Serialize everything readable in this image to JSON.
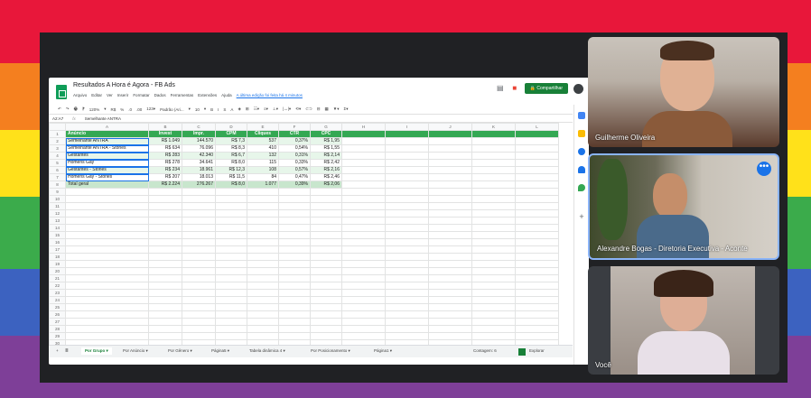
{
  "frame": {
    "stripe_colors": [
      "#e8173a",
      "#f47f1f",
      "#ffe11a",
      "#3bab4b",
      "#3c62c0",
      "#7e3f98"
    ]
  },
  "sheet": {
    "doc_title": "Resultados A Hora é Agora - FB Ads",
    "menus": [
      "Arquivo",
      "Editar",
      "Ver",
      "Inserir",
      "Formatar",
      "Dados",
      "Ferramentas",
      "Extensões",
      "Ajuda"
    ],
    "last_edit": "A última edição foi feita há 4 minutos",
    "share_label": "Compartilhar",
    "toolbar_items": [
      "↶",
      "↷",
      "🖶",
      "⁋",
      "120%",
      "▾",
      "R$",
      "%",
      ".0",
      ".00",
      "123▾",
      "Padrão (Ari...",
      "▾",
      "10",
      "▾",
      "B",
      "I",
      "S",
      "A",
      "◈",
      "⊞",
      "☷▾",
      "≡▾",
      "⊥▾",
      "|↔|▾",
      "⟲▾",
      "⊂⊃",
      "⊟",
      "▦",
      "▼▾",
      "Σ▾"
    ],
    "cell_ref": "A2:A7",
    "fx": "fx",
    "formula_value": "Semelhante ANTRA",
    "columns": [
      "A",
      "B",
      "C",
      "D",
      "E",
      "F",
      "G",
      "H",
      "I",
      "J",
      "K",
      "L"
    ],
    "headers": [
      "Anúncio",
      "Invest",
      "Impr.",
      "CPM",
      "Cliques",
      "CTR",
      "CPC"
    ],
    "rows": [
      [
        "Semelhante ANTRA",
        "R$ 1.049",
        "144.570",
        "R$ 7,3",
        "537",
        "0,37%",
        "R$ 1,95"
      ],
      [
        "Semelhante ANTRA - Stories",
        "R$ 634",
        "76.096",
        "R$ 8,3",
        "410",
        "0,54%",
        "R$ 1,55"
      ],
      [
        "Gestantes",
        "R$ 283",
        "42.340",
        "R$ 6,7",
        "132",
        "0,31%",
        "R$ 2,14"
      ],
      [
        "Homens Gay",
        "R$ 278",
        "34.641",
        "R$ 8,0",
        "115",
        "0,33%",
        "R$ 2,42"
      ],
      [
        "Gestantes - Stories",
        "R$ 234",
        "18.961",
        "R$ 12,3",
        "108",
        "0,57%",
        "R$ 2,16"
      ],
      [
        "Homens Gay - Stories",
        "R$ 207",
        "18.013",
        "R$ 11,5",
        "84",
        "0,47%",
        "R$ 2,46"
      ]
    ],
    "total": [
      "Total geral",
      "R$ 2.224",
      "276.267",
      "R$ 8,0",
      "1.077",
      "0,39%",
      "R$ 2,06"
    ],
    "row_numbers": [
      "1",
      "2",
      "3",
      "4",
      "5",
      "6",
      "7",
      "8",
      "9",
      "10",
      "11",
      "12",
      "13",
      "14",
      "15",
      "16",
      "17",
      "18",
      "19",
      "20",
      "21",
      "22",
      "23",
      "24",
      "25",
      "26",
      "27",
      "28",
      "29",
      "30"
    ],
    "tabs": [
      "Por Grupo ▾",
      "Por Anúncio ▾",
      "Por Gênero ▾",
      "Página5 ▾",
      "Tabela dinâmica 4 ▾",
      "Por Posicionamento ▾",
      "Página1 ▾"
    ],
    "tab_add": "+",
    "tab_list": "≣",
    "count_label": "Contagem: 6",
    "explore_label": "Explorar"
  },
  "participants": [
    {
      "name": "Guilherme Oliveira"
    },
    {
      "name": "Alexandre Bogas - Diretoria Executiva - Aconte"
    },
    {
      "name": "Você"
    }
  ]
}
